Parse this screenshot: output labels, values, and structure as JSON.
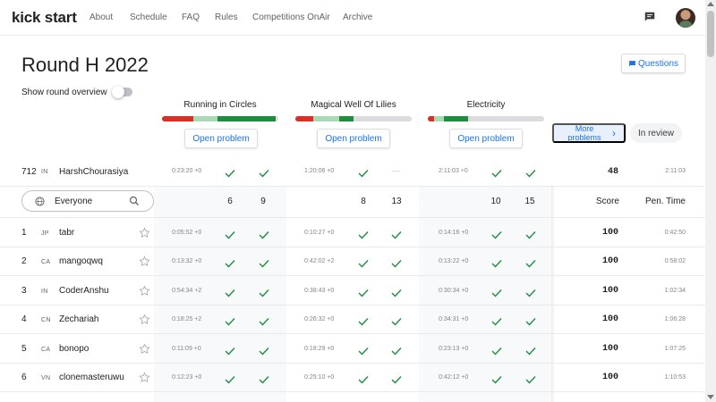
{
  "header": {
    "logo": "kick start",
    "nav": [
      "About",
      "Schedule",
      "FAQ",
      "Rules",
      "Competitions OnAir",
      "Archive"
    ]
  },
  "page": {
    "title": "Round H 2022",
    "questions_label": "Questions",
    "overview_label": "Show round overview",
    "more_problems_label": "More problems",
    "in_review_label": "In review",
    "open_problem_label": "Open problem"
  },
  "problems": [
    {
      "name": "Running in Circles",
      "progress": {
        "red": 0.27,
        "light": 0.21,
        "green": 0.5
      }
    },
    {
      "name": "Magical Well Of Lilies",
      "progress": {
        "red": 0.15,
        "light": 0.23,
        "green": 0.12
      }
    },
    {
      "name": "Electricity",
      "progress": {
        "red": 0.05,
        "light": 0.09,
        "green": 0.21
      }
    }
  ],
  "my_row": {
    "rank": "712",
    "country": "IN",
    "name": "HarshChourasiya",
    "cells": [
      {
        "time": "0:23:20 +0",
        "a": "check",
        "b": "check"
      },
      {
        "time": "1:20:06 +0",
        "a": "check",
        "b": "dash"
      },
      {
        "time": "2:11:03 +0",
        "a": "check",
        "b": "check"
      }
    ],
    "score": "48",
    "pen": "2:11:03"
  },
  "filter": {
    "value": "Everyone",
    "counts": [
      "6",
      "9",
      "8",
      "13",
      "10",
      "15"
    ],
    "score_header": "Score",
    "pen_header": "Pen. Time"
  },
  "rows": [
    {
      "rank": "1",
      "country": "JP",
      "name": "tabr",
      "times": [
        "0:05:52 +0",
        "0:10:27 +0",
        "0:14:16 +0"
      ],
      "score": "100",
      "pen": "0:42:50"
    },
    {
      "rank": "2",
      "country": "CA",
      "name": "mangoqwq",
      "times": [
        "0:13:32 +0",
        "0:42:02 +2",
        "0:13:22 +0"
      ],
      "score": "100",
      "pen": "0:58:02"
    },
    {
      "rank": "3",
      "country": "IN",
      "name": "CoderAnshu",
      "times": [
        "0:54:34 +2",
        "0:38:43 +0",
        "0:30:34 +0"
      ],
      "score": "100",
      "pen": "1:02:34"
    },
    {
      "rank": "4",
      "country": "CN",
      "name": "Zechariah",
      "times": [
        "0:18:25 +2",
        "0:26:32 +0",
        "0:34:31 +0"
      ],
      "score": "100",
      "pen": "1:06:28"
    },
    {
      "rank": "5",
      "country": "CA",
      "name": "bonopo",
      "times": [
        "0:11:09 +0",
        "0:18:29 +0",
        "0:23:13 +0"
      ],
      "score": "100",
      "pen": "1:07:25"
    },
    {
      "rank": "6",
      "country": "VN",
      "name": "clonemasteruwu",
      "times": [
        "0:12:23 +0",
        "0:25:10 +0",
        "0:42:12 +0"
      ],
      "score": "100",
      "pen": "1:10:53"
    }
  ],
  "colors": {
    "accent": "#1a73e8",
    "green": "#1e8e3e",
    "red": "#d93025",
    "light_green": "#a8dab5"
  }
}
